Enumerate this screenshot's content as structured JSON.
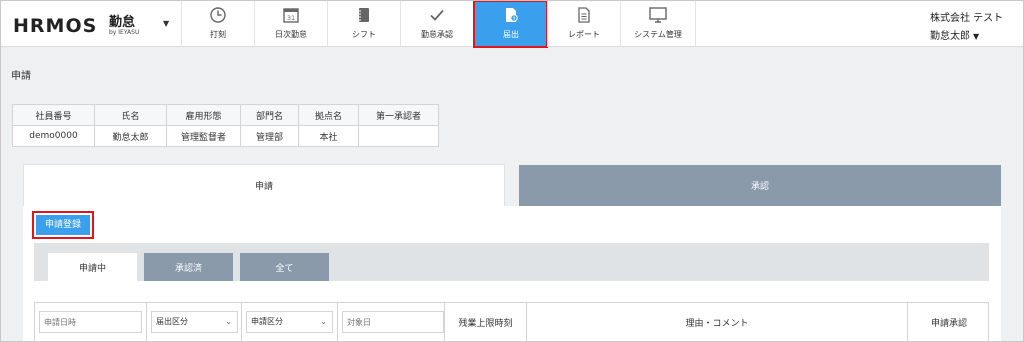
{
  "app": {
    "logo_text": "HRMOS",
    "logo_jp": "勤怠",
    "logo_by": "by IEYASU",
    "company": "株式会社 テスト",
    "user": "勤怠太郎"
  },
  "nav": [
    {
      "label": "打刻",
      "icon": "clock-icon"
    },
    {
      "label": "日次勤怠",
      "icon": "calendar-icon"
    },
    {
      "label": "シフト",
      "icon": "notebook-icon"
    },
    {
      "label": "勤怠承認",
      "icon": "check-icon"
    },
    {
      "label": "届出",
      "icon": "document-icon",
      "active": true
    },
    {
      "label": "レポート",
      "icon": "report-icon"
    },
    {
      "label": "システム管理",
      "icon": "monitor-icon"
    }
  ],
  "page": {
    "title": "申請"
  },
  "info_table": {
    "headers": [
      "社員番号",
      "氏名",
      "雇用形態",
      "部門名",
      "拠点名",
      "第一承認者"
    ],
    "row": [
      "demo0000",
      "勤怠太郎",
      "管理監督者",
      "管理部",
      "本社",
      ""
    ]
  },
  "main_tabs": {
    "apply": "申請",
    "approve": "承認"
  },
  "register_button": "申請登録",
  "sub_tabs": [
    "申請中",
    "承認済",
    "全て"
  ],
  "filters": {
    "date_placeholder": "申請日時",
    "type_select": "届出区分",
    "kind_select": "申請区分",
    "target_placeholder": "対象日",
    "overtime_header": "残業上限時刻",
    "reason_header": "理由・コメント",
    "approval_header": "申請承認"
  },
  "colors": {
    "accent": "#3aa0ee",
    "tab_inactive": "#8a9aab",
    "highlight": "#e0161e"
  }
}
